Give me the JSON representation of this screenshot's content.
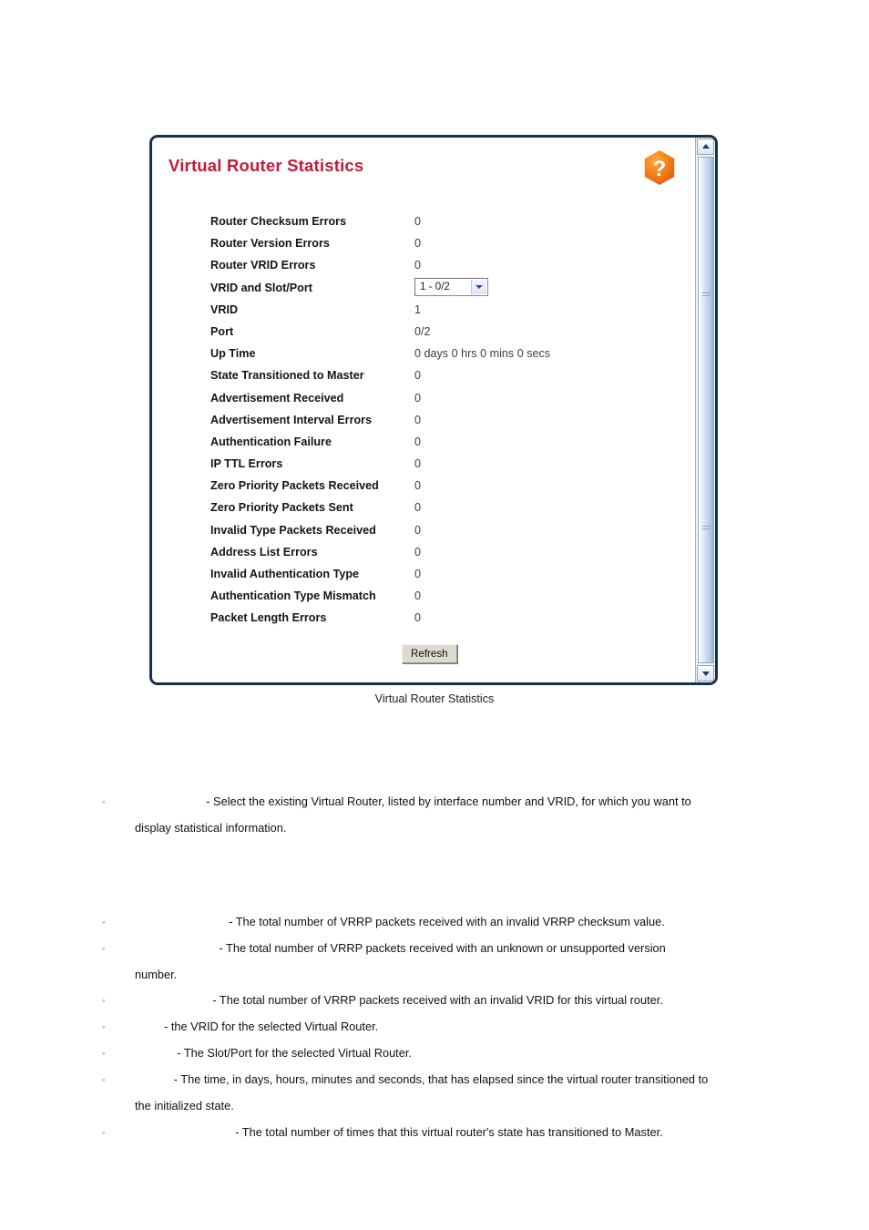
{
  "panel": {
    "title": "Virtual Router Statistics",
    "help_icon_glyph": "?",
    "help_icon_color": "#f07818",
    "title_color": "#c31b38",
    "border_color": "#14304f",
    "rows": [
      {
        "label": "Router Checksum Errors",
        "value": "0",
        "type": "text"
      },
      {
        "label": "Router Version Errors",
        "value": "0",
        "type": "text"
      },
      {
        "label": "Router VRID Errors",
        "value": "0",
        "type": "text"
      },
      {
        "label": "VRID and Slot/Port",
        "value": "1 - 0/2",
        "type": "select"
      },
      {
        "label": "VRID",
        "value": "1",
        "type": "text"
      },
      {
        "label": "Port",
        "value": "0/2",
        "type": "text"
      },
      {
        "label": "Up Time",
        "value": "0 days 0 hrs 0 mins 0 secs",
        "type": "text"
      },
      {
        "label": "State Transitioned to Master",
        "value": "0",
        "type": "text"
      },
      {
        "label": "Advertisement Received",
        "value": "0",
        "type": "text"
      },
      {
        "label": "Advertisement Interval Errors",
        "value": "0",
        "type": "text"
      },
      {
        "label": "Authentication Failure",
        "value": "0",
        "type": "text"
      },
      {
        "label": "IP TTL Errors",
        "value": "0",
        "type": "text"
      },
      {
        "label": "Zero Priority Packets Received",
        "value": "0",
        "type": "text"
      },
      {
        "label": "Zero Priority Packets Sent",
        "value": "0",
        "type": "text"
      },
      {
        "label": "Invalid Type Packets Received",
        "value": "0",
        "type": "text"
      },
      {
        "label": "Address List Errors",
        "value": "0",
        "type": "text"
      },
      {
        "label": "Invalid Authentication Type",
        "value": "0",
        "type": "text"
      },
      {
        "label": "Authentication Type Mismatch",
        "value": "0",
        "type": "text"
      },
      {
        "label": "Packet Length Errors",
        "value": "0",
        "type": "text"
      }
    ],
    "refresh_label": "Refresh",
    "scrollbar": {
      "up_arrow": "▲",
      "down_arrow": "▼"
    }
  },
  "caption": "Virtual Router Statistics",
  "bullets": [
    {
      "marker": "◦",
      "text": "                      - Select the existing Virtual Router, listed by interface number and VRID, for which you want to",
      "continuation": "display statistical information."
    },
    {
      "marker": "◦",
      "text": "                             - The total number of VRRP packets received with an invalid VRRP checksum value.",
      "continuation": ""
    },
    {
      "marker": "◦",
      "text": "                          - The total number of VRRP packets received with an unknown or unsupported version",
      "continuation": "number."
    },
    {
      "marker": "◦",
      "text": "                        - The total number of VRRP packets received with an invalid VRID for this virtual router.",
      "continuation": ""
    },
    {
      "marker": "◦",
      "text": "         - the VRID for the selected Virtual Router.",
      "continuation": ""
    },
    {
      "marker": "◦",
      "text": "             - The Slot/Port for the selected Virtual Router.",
      "continuation": ""
    },
    {
      "marker": "◦",
      "text": "            - The time, in days, hours, minutes and seconds, that has elapsed since the virtual router transitioned to",
      "continuation": "the initialized state."
    },
    {
      "marker": "◦",
      "text": "                               - The total number of times that this virtual router's state has transitioned to Master.",
      "continuation": ""
    }
  ]
}
